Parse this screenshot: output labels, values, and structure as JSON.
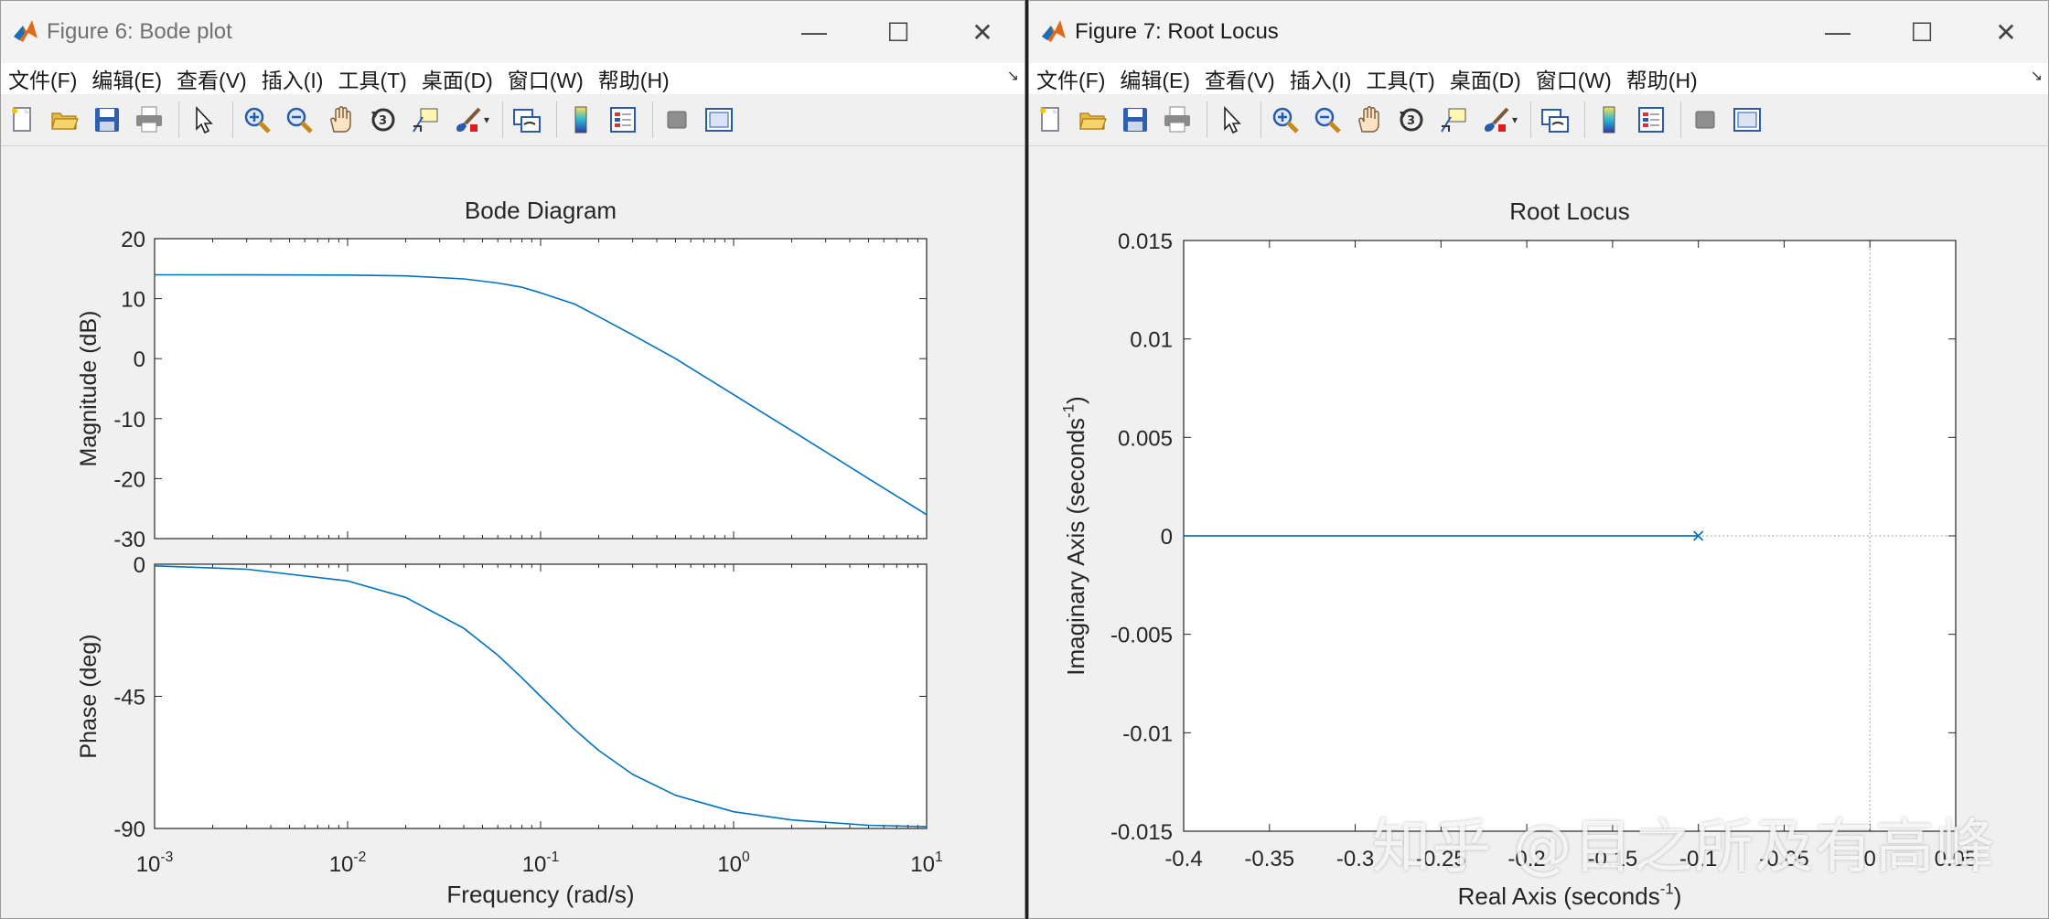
{
  "windows": [
    {
      "id": "bode",
      "title": "Figure 6: Bode plot",
      "menu": [
        "文件(F)",
        "编辑(E)",
        "查看(V)",
        "插入(I)",
        "工具(T)",
        "桌面(D)",
        "窗口(W)",
        "帮助(H)"
      ]
    },
    {
      "id": "rlocus",
      "title": "Figure 7: Root Locus",
      "menu": [
        "文件(F)",
        "编辑(E)",
        "查看(V)",
        "插入(I)",
        "工具(T)",
        "桌面(D)",
        "窗口(W)",
        "帮助(H)"
      ]
    }
  ],
  "window_controls": {
    "minimize": "—",
    "maximize": "☐",
    "close": "✕"
  },
  "toolbar_icons": [
    "new-figure-icon",
    "open-file-icon",
    "save-icon",
    "print-icon",
    "pointer-icon",
    "zoom-in-icon",
    "zoom-out-icon",
    "pan-hand-icon",
    "rotate-3d-icon",
    "data-cursor-icon",
    "brush-icon",
    "link-plot-icon",
    "colorbar-icon",
    "legend-icon",
    "hide-plot-tools-icon",
    "show-plot-tools-icon"
  ],
  "colors": {
    "line": "#0072bd",
    "axes_bg": "#ffffff",
    "figure_bg": "#f0f0f0",
    "text": "#262626"
  },
  "watermark": "知乎 @目之所及有高峰",
  "chart_data": [
    {
      "type": "line",
      "title": "Bode Diagram",
      "xlabel": "Frequency  (rad/s)",
      "xscale": "log",
      "xlim": [
        0.001,
        10
      ],
      "xticks": [
        {
          "base": "10",
          "exp": "-3"
        },
        {
          "base": "10",
          "exp": "-2"
        },
        {
          "base": "10",
          "exp": "-1"
        },
        {
          "base": "10",
          "exp": "0"
        },
        {
          "base": "10",
          "exp": "1"
        }
      ],
      "subplots": [
        {
          "name": "magnitude",
          "ylabel": "Magnitude (dB)",
          "ylim": [
            -30,
            20
          ],
          "yticks": [
            "20",
            "10",
            "0",
            "-10",
            "-20",
            "-30"
          ],
          "x": [
            0.001,
            0.003,
            0.01,
            0.02,
            0.04,
            0.06,
            0.08,
            0.1,
            0.15,
            0.2,
            0.3,
            0.5,
            1,
            2,
            5,
            10
          ],
          "y": [
            13.98,
            13.97,
            13.94,
            13.8,
            13.3,
            12.6,
            11.9,
            10.97,
            9.1,
            7.0,
            3.95,
            -0.0,
            -6.0,
            -12.0,
            -20.0,
            -26.0
          ]
        },
        {
          "name": "phase",
          "ylabel": "Phase (deg)",
          "ylim": [
            -90,
            0
          ],
          "yticks": [
            "0",
            "-45",
            "-90"
          ],
          "x": [
            0.001,
            0.003,
            0.01,
            0.02,
            0.04,
            0.06,
            0.08,
            0.1,
            0.15,
            0.2,
            0.3,
            0.5,
            1,
            2,
            5,
            10
          ],
          "y": [
            -0.57,
            -1.7,
            -5.7,
            -11.3,
            -21.8,
            -31.0,
            -38.7,
            -45.0,
            -56.3,
            -63.4,
            -71.6,
            -78.7,
            -84.3,
            -87.1,
            -88.9,
            -89.4
          ]
        }
      ],
      "grid": false
    },
    {
      "type": "scatter",
      "title": "Root Locus",
      "xlabel": {
        "text": "Real Axis (seconds",
        "sup": "-1",
        "close": ")"
      },
      "ylabel": {
        "text": "Imaginary Axis (seconds",
        "sup": "-1",
        "close": ")"
      },
      "xlim": [
        -0.4,
        0.05
      ],
      "ylim": [
        -0.015,
        0.015
      ],
      "xticks": [
        "-0.4",
        "-0.35",
        "-0.3",
        "-0.25",
        "-0.2",
        "-0.15",
        "-0.1",
        "-0.05",
        "0",
        "0.05"
      ],
      "yticks": [
        "0.015",
        "0.01",
        "0.005",
        "0",
        "-0.005",
        "-0.01",
        "-0.015"
      ],
      "locus": {
        "x": [
          -0.4,
          -0.1
        ],
        "y": [
          0,
          0
        ]
      },
      "poles": [
        {
          "x": -0.1,
          "y": 0
        }
      ],
      "reference_lines": {
        "x0_dotted": true,
        "y0_dotted": true
      }
    }
  ]
}
